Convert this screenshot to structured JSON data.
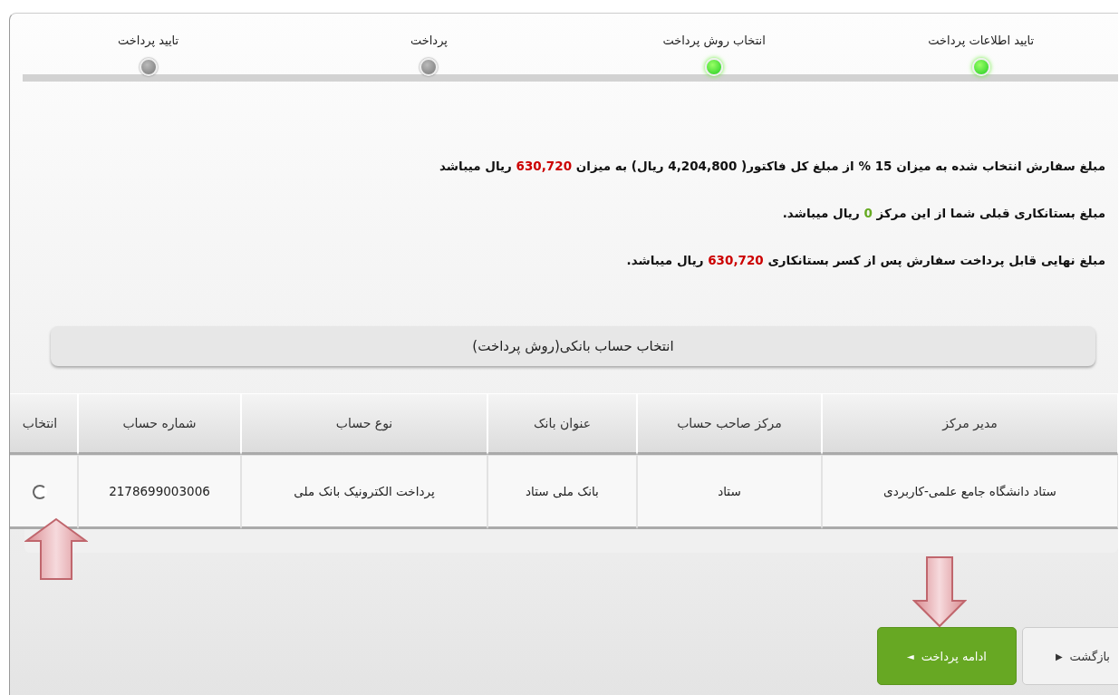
{
  "steps": [
    {
      "label": "تایید اطلاعات پرداخت",
      "done": true
    },
    {
      "label": "انتخاب روش پرداخت",
      "done": true
    },
    {
      "label": "پرداخت",
      "done": false
    },
    {
      "label": "تایید پرداخت",
      "done": false
    }
  ],
  "messages": [
    {
      "before": "مبلغ سفارش انتخاب شده به میزان 15 % از مبلغ کل فاکتور( 4,204,800 ریال) به میزان ",
      "amount": "630,720",
      "color": "#cc0000",
      "after": " ریال میباشد"
    },
    {
      "before": "مبلغ بستانکاری قبلی شما از این مرکز ",
      "amount": "0",
      "color": "#66aa22",
      "after": " ریال میباشد."
    },
    {
      "before": "مبلغ نهایی قابل پرداخت سفارش پس از کسر بستانکاری ",
      "amount": "630,720",
      "color": "#cc0000",
      "after": " ریال میباشد."
    }
  ],
  "section_title": "انتخاب حساب بانکی(روش پرداخت)",
  "table": {
    "columns": [
      "مدیر مرکز",
      "مرکز صاحب حساب",
      "عنوان بانک",
      "نوع حساب",
      "شماره حساب",
      "انتخاب"
    ],
    "rows": [
      {
        "cells": [
          "ستاد دانشگاه جامع علمی-کاربردی",
          "ستاد",
          "بانک ملی ستاد",
          "پرداخت الکترونیک بانک ملی",
          "2178699003006"
        ],
        "selected": false
      }
    ]
  },
  "buttons": [
    {
      "kind": "secondary",
      "label": "بازگشت",
      "icon": "▶"
    },
    {
      "kind": "primary",
      "label": "ادامه پرداخت",
      "icon": "◄"
    }
  ]
}
